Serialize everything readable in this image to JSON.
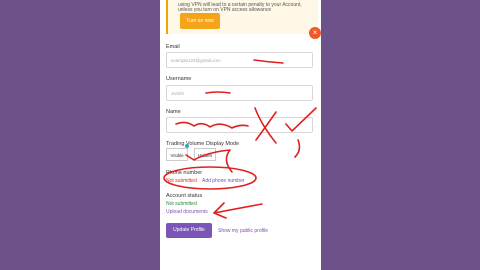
{
  "notice": {
    "line1": "using VPN will lead to a certain penalty to your Account,",
    "line2": "unless you turn on VPN access allowance",
    "button": "Turn on now"
  },
  "fab_icon": "close-icon",
  "email": {
    "label": "Email",
    "value": "example123@gmail.com"
  },
  "username": {
    "label": "Username",
    "value": "Jsmith"
  },
  "name": {
    "label": "Name"
  },
  "trading_volume": {
    "label": "Trading Volume Display Mode",
    "visible": "Visible",
    "hidden": "Hidden"
  },
  "phone": {
    "label": "Phone number",
    "status": "Not submitted",
    "action": "Add phone number"
  },
  "account_status": {
    "label": "Account status",
    "status": "Not submitted",
    "action": "Upload documents"
  },
  "actions": {
    "update": "Update Profile",
    "public_profile": "Show my public profile"
  },
  "colors": {
    "accent": "#7b56b6",
    "warning": "#f5a41a",
    "annotation": "#e02020"
  }
}
